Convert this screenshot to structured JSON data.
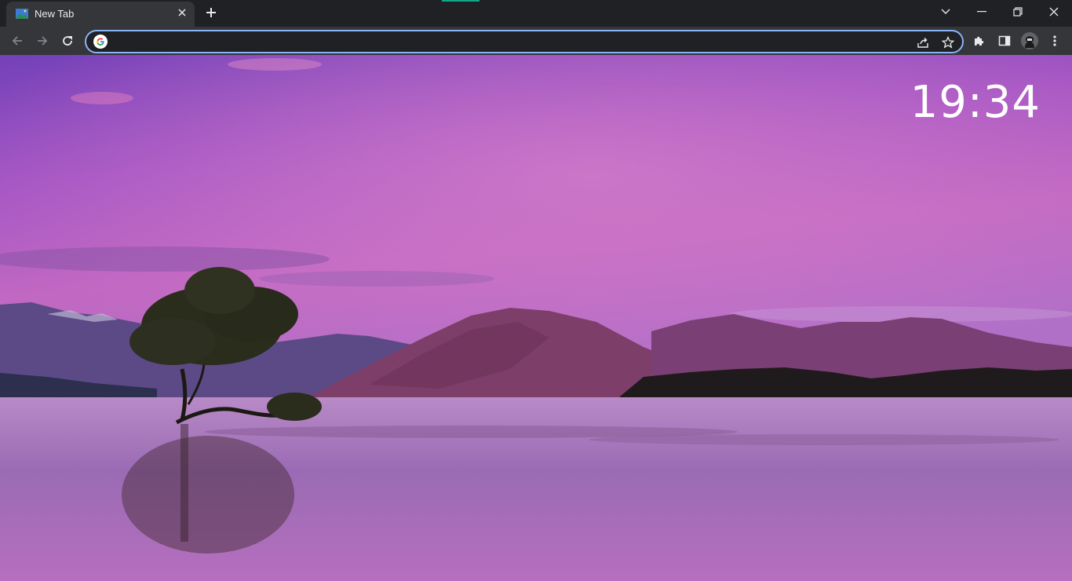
{
  "tab": {
    "title": "New Tab"
  },
  "omnibox": {
    "value": "",
    "placeholder": ""
  },
  "clock": {
    "time": "19:34"
  },
  "icons": {
    "favicon": "landscape-favicon-icon",
    "tab_close": "close-icon",
    "new_tab": "plus-icon",
    "tab_search": "chevron-down-icon",
    "minimize": "minimize-icon",
    "restore": "restore-icon",
    "close_window": "close-icon",
    "back": "back-arrow-icon",
    "forward": "forward-arrow-icon",
    "reload": "reload-icon",
    "google": "google-icon",
    "share": "share-icon",
    "bookmark": "star-icon",
    "extensions": "puzzle-icon",
    "side_panel": "side-panel-icon",
    "profile": "avatar",
    "menu": "kebab-menu-icon"
  },
  "colors": {
    "accent": "#8ab4f8",
    "frame": "#202124",
    "toolbar": "#35363a"
  }
}
